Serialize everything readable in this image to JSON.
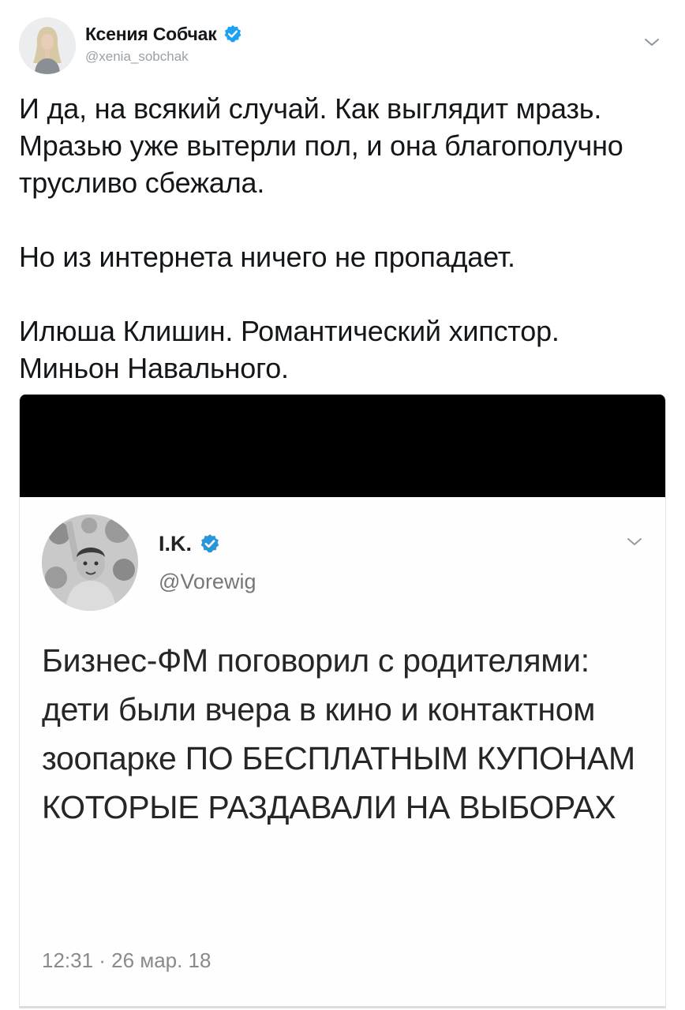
{
  "tweet": {
    "author_name": "Ксения Собчак",
    "author_handle": "@xenia_sobchak",
    "paragraphs": [
      "И да, на всякий случай. Как выглядит мразь. Мразью уже вытерли пол, и она благополучно трусливо сбежала.",
      "Но из интернета ничего не пропадает.",
      "Илюша Клишин. Романтический хипстор. Миньон Навального."
    ]
  },
  "embedded_tweet": {
    "author_name": "I.K.",
    "author_handle": "@Vorewig",
    "text": "Бизнес-ФМ поговорил с родителями: дети были вчера в кино и контактном зоопарке ПО БЕСПЛАТНЫМ КУПОНАМ КОТОРЫЕ РАЗДАВАЛИ НА ВЫБОРАХ",
    "timestamp": "12:31 · 26 мар. 18"
  },
  "icons": {
    "verified": "verified-badge-icon",
    "menu": "chevron-down-icon"
  },
  "colors": {
    "verified_blue": "#1da1f2",
    "text": "#14171a",
    "secondary_text": "#9aa1a8"
  }
}
